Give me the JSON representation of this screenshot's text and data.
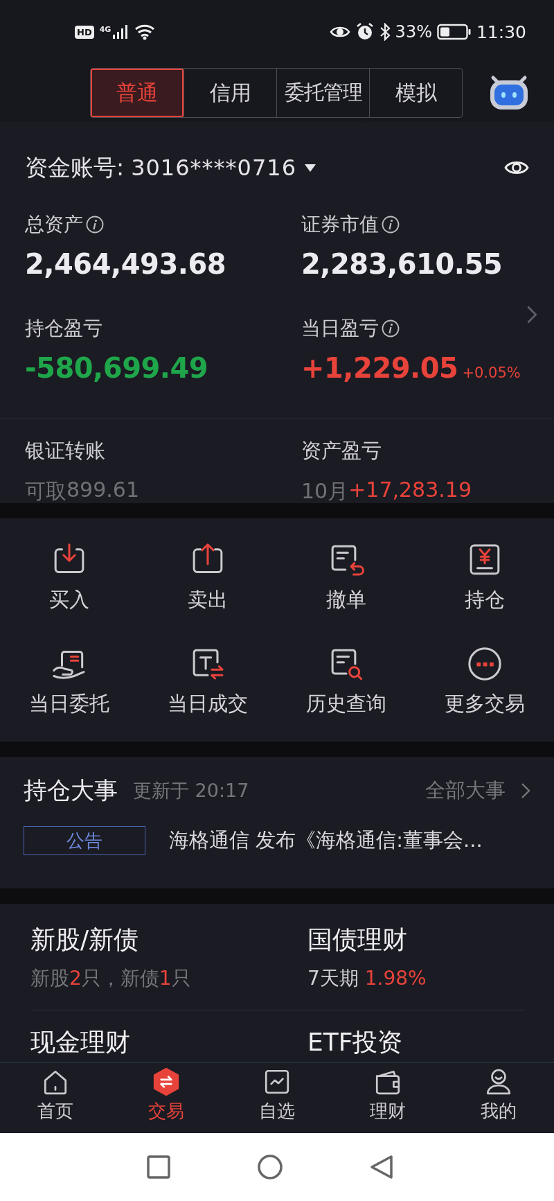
{
  "status_bar": {
    "badges": [
      "HD",
      "4G"
    ],
    "battery": "33%",
    "time": "11:30"
  },
  "tabs": [
    {
      "label": "普通",
      "selected": true
    },
    {
      "label": "信用",
      "selected": false
    },
    {
      "label": "委托管理",
      "selected": false
    },
    {
      "label": "模拟",
      "selected": false
    }
  ],
  "account": {
    "label": "资金账号:",
    "number": "3016****0716"
  },
  "metrics": [
    {
      "label": "总资产",
      "info": true,
      "value": "2,464,493.68",
      "color": "#ececf0"
    },
    {
      "label": "证券市值",
      "info": true,
      "value": "2,283,610.55",
      "color": "#ececf0"
    },
    {
      "label": "持仓盈亏",
      "info": false,
      "value": "-580,699.49",
      "color": "#1fa64a"
    },
    {
      "label": "当日盈亏",
      "info": true,
      "value": "+1,229.05",
      "color": "#e8433a",
      "change": "+0.05%"
    }
  ],
  "summary": [
    {
      "label": "银证转账",
      "prefix": "可取",
      "amount": "899.61",
      "color": "#707076"
    },
    {
      "label": "资产盈亏",
      "prefix": "10月",
      "amount": "+17,283.19",
      "color": "#e8433a"
    }
  ],
  "actions": [
    {
      "label": "买入",
      "kind": "buy"
    },
    {
      "label": "卖出",
      "kind": "sell"
    },
    {
      "label": "撤单",
      "kind": "cancel"
    },
    {
      "label": "持仓",
      "kind": "position"
    },
    {
      "label": "当日委托",
      "kind": "entrust"
    },
    {
      "label": "当日成交",
      "kind": "deal"
    },
    {
      "label": "历史查询",
      "kind": "history"
    },
    {
      "label": "更多交易",
      "kind": "more"
    }
  ],
  "events": {
    "title": "持仓大事",
    "updated": "更新于 20:17",
    "link": "全部大事",
    "items": [
      {
        "tag": "公告",
        "text": "海格通信 发布《海格通信:董事会..."
      }
    ]
  },
  "finance": [
    {
      "title": "新股/新债",
      "detail": [
        {
          "text": "新股",
          "color": "#75757c"
        },
        {
          "text": "2",
          "color": "#e8433a"
        },
        {
          "text": "只，新债",
          "color": "#75757c"
        },
        {
          "text": "1",
          "color": "#e8433a"
        },
        {
          "text": "只",
          "color": "#75757c"
        }
      ]
    },
    {
      "title": "国债理财",
      "detail": [
        {
          "text": "7天期 ",
          "color": "#cfcfd4"
        },
        {
          "text": "1.98%",
          "color": "#e8433a"
        }
      ]
    },
    {
      "title": "现金理财"
    },
    {
      "title": "ETF投资"
    }
  ],
  "nav": [
    {
      "label": "首页",
      "kind": "home",
      "selected": false
    },
    {
      "label": "交易",
      "kind": "trade",
      "selected": true
    },
    {
      "label": "自选",
      "kind": "watchlist",
      "selected": false
    },
    {
      "label": "理财",
      "kind": "wealth",
      "selected": false
    },
    {
      "label": "我的",
      "kind": "profile",
      "selected": false
    }
  ]
}
